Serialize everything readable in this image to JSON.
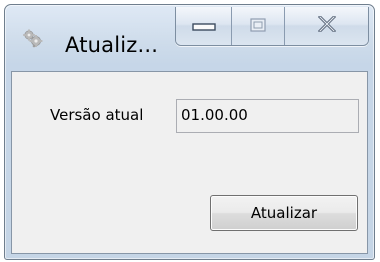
{
  "window": {
    "title": "Atualiz...",
    "app_icon": "gear-cog-icon",
    "controls": {
      "minimize_icon": "minimize-icon",
      "maximize_icon": "maximize-icon",
      "close_icon": "close-icon"
    }
  },
  "form": {
    "version_label": "Versão atual",
    "version_value": "01.00.00",
    "update_button_label": "Atualizar"
  },
  "colors": {
    "frame_border": "#6f7e8d",
    "client_background": "#f0f0f0",
    "titlebar_glass": "#cddbea"
  }
}
